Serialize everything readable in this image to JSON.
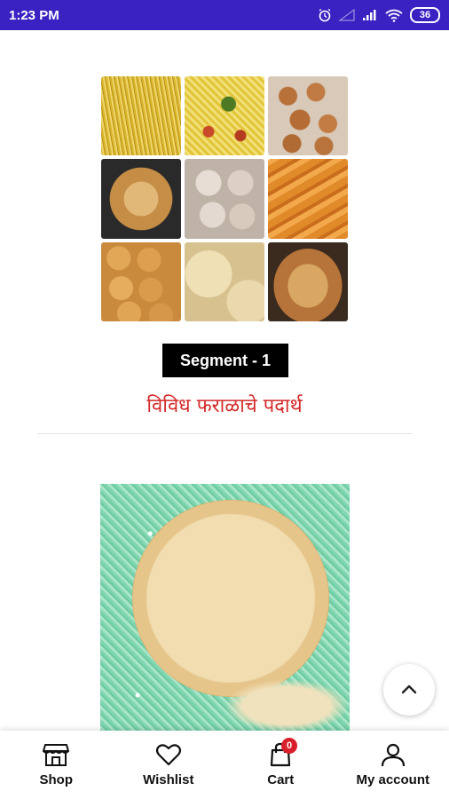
{
  "status_bar": {
    "time": "1:23 PM",
    "battery": "36",
    "icons": [
      "alarm-icon",
      "signal-icon",
      "signal-icon",
      "wifi-icon",
      "battery-icon"
    ]
  },
  "collage": {
    "tiles": [
      "sev",
      "chivda",
      "chakli",
      "karanji",
      "puri",
      "shankarpali",
      "ladoo",
      "puri-fried",
      "shankarpale"
    ]
  },
  "segment": {
    "label": "Segment - 1",
    "title": "विविध फराळाचे पदार्थ"
  },
  "bottom_nav": {
    "items": [
      {
        "label": "Shop",
        "icon": "store-icon"
      },
      {
        "label": "Wishlist",
        "icon": "heart-icon"
      },
      {
        "label": "Cart",
        "icon": "shopping-bag-icon",
        "badge": "0"
      },
      {
        "label": "My account",
        "icon": "user-icon"
      }
    ]
  },
  "colors": {
    "status_bar": "#3a21c2",
    "title": "#d42a2a",
    "badge": "#d81f2a"
  }
}
